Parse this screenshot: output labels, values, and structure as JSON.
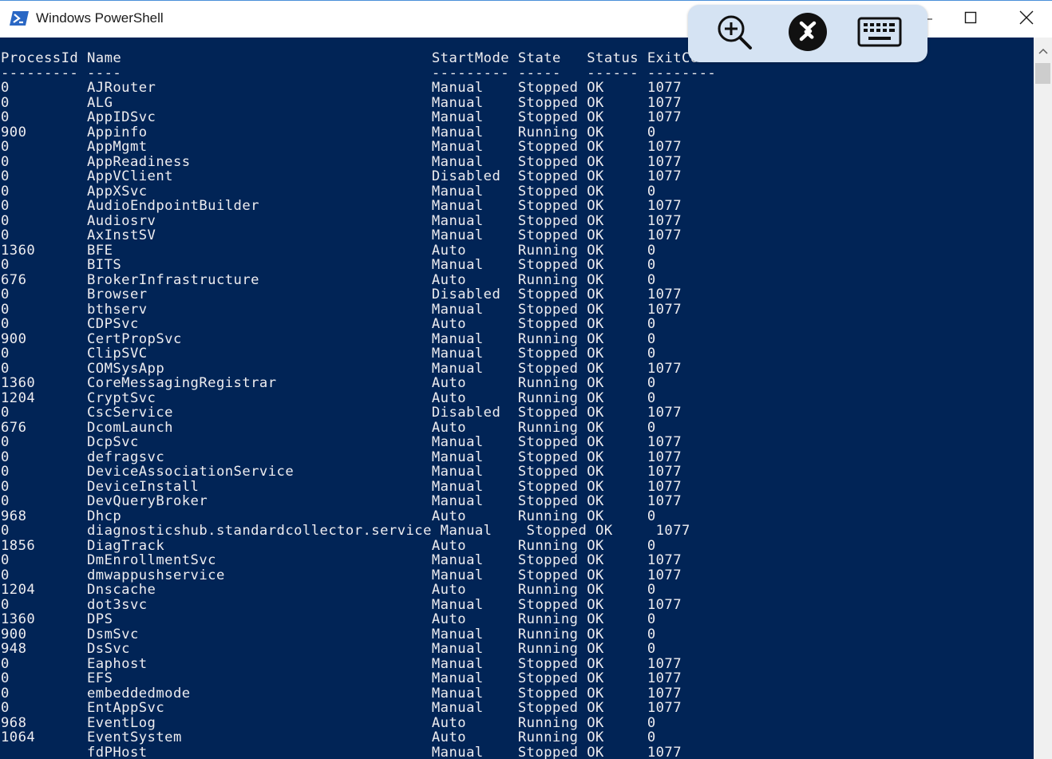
{
  "window": {
    "title": "Windows PowerShell",
    "icon": "powershell-icon",
    "controls": [
      "minimize-icon",
      "maximize-icon",
      "close-icon"
    ]
  },
  "remote_toolbar": {
    "buttons": [
      {
        "icon": "zoom-in-icon"
      },
      {
        "icon": "remote-connect-icon"
      },
      {
        "icon": "keyboard-icon"
      }
    ],
    "background": "#d5e3f3"
  },
  "colors": {
    "console_background": "#012456",
    "console_text": "#eeedf0"
  },
  "console": {
    "lines": [
      "ProcessId Name                                    StartMode State   Status ExitCode",
      "--------- ----                                    --------- -----   ------ --------",
      "0         AJRouter                                Manual    Stopped OK     1077",
      "0         ALG                                     Manual    Stopped OK     1077",
      "0         AppIDSvc                                Manual    Stopped OK     1077",
      "900       Appinfo                                 Manual    Running OK     0",
      "0         AppMgmt                                 Manual    Stopped OK     1077",
      "0         AppReadiness                            Manual    Stopped OK     1077",
      "0         AppVClient                              Disabled  Stopped OK     1077",
      "0         AppXSvc                                 Manual    Stopped OK     0",
      "0         AudioEndpointBuilder                    Manual    Stopped OK     1077",
      "0         Audiosrv                                Manual    Stopped OK     1077",
      "0         AxInstSV                                Manual    Stopped OK     1077",
      "1360      BFE                                     Auto      Running OK     0",
      "0         BITS                                    Manual    Stopped OK     0",
      "676       BrokerInfrastructure                    Auto      Running OK     0",
      "0         Browser                                 Disabled  Stopped OK     1077",
      "0         bthserv                                 Manual    Stopped OK     1077",
      "0         CDPSvc                                  Auto      Stopped OK     0",
      "900       CertPropSvc                             Manual    Running OK     0",
      "0         ClipSVC                                 Manual    Stopped OK     0",
      "0         COMSysApp                               Manual    Stopped OK     1077",
      "1360      CoreMessagingRegistrar                  Auto      Running OK     0",
      "1204      CryptSvc                                Auto      Running OK     0",
      "0         CscService                              Disabled  Stopped OK     1077",
      "676       DcomLaunch                              Auto      Running OK     0",
      "0         DcpSvc                                  Manual    Stopped OK     1077",
      "0         defragsvc                               Manual    Stopped OK     1077",
      "0         DeviceAssociationService                Manual    Stopped OK     1077",
      "0         DeviceInstall                           Manual    Stopped OK     1077",
      "0         DevQueryBroker                          Manual    Stopped OK     1077",
      "968       Dhcp                                    Auto      Running OK     0",
      "0         diagnosticshub.standardcollector.service Manual    Stopped OK     1077",
      "1856      DiagTrack                               Auto      Running OK     0",
      "0         DmEnrollmentSvc                         Manual    Stopped OK     1077",
      "0         dmwappushservice                        Manual    Stopped OK     1077",
      "1204      Dnscache                                Auto      Running OK     0",
      "0         dot3svc                                 Manual    Stopped OK     1077",
      "1360      DPS                                     Auto      Running OK     0",
      "900       DsmSvc                                  Manual    Running OK     0",
      "948       DsSvc                                   Manual    Running OK     0",
      "0         Eaphost                                 Manual    Stopped OK     1077",
      "0         EFS                                     Manual    Stopped OK     1077",
      "0         embeddedmode                            Manual    Stopped OK     1077",
      "0         EntAppSvc                               Manual    Stopped OK     1077",
      "968       EventLog                                Auto      Running OK     0",
      "1064      EventSystem                             Auto      Running OK     0",
      "          fdPHost                                 Manual    Stopped OK     1077"
    ]
  }
}
